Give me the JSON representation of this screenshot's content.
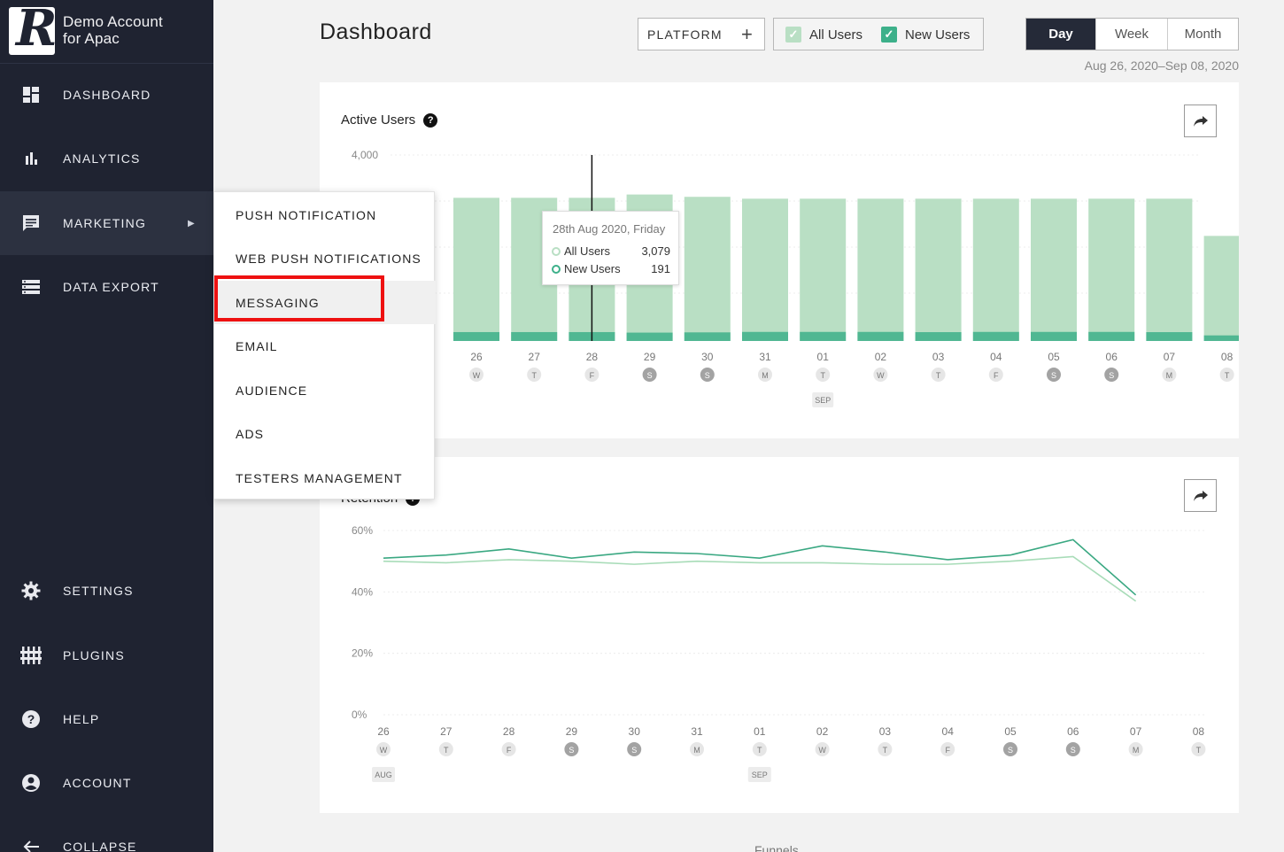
{
  "brand": {
    "line1": "Demo Account",
    "line2": "for Apac",
    "logo_letter": "R"
  },
  "sidebar": {
    "items": [
      {
        "label": "DASHBOARD",
        "icon": "dashboard-icon"
      },
      {
        "label": "ANALYTICS",
        "icon": "bar-chart-icon"
      },
      {
        "label": "MARKETING",
        "icon": "message-icon",
        "active": true
      },
      {
        "label": "DATA EXPORT",
        "icon": "data-export-icon"
      },
      {
        "label": "SETTINGS",
        "icon": "gear-icon"
      },
      {
        "label": "PLUGINS",
        "icon": "plugins-icon"
      },
      {
        "label": "HELP",
        "icon": "help-icon"
      },
      {
        "label": "ACCOUNT",
        "icon": "account-icon"
      },
      {
        "label": "COLLAPSE",
        "icon": "arrow-left-icon"
      }
    ]
  },
  "header": {
    "title": "Dashboard",
    "platform_label": "PLATFORM",
    "platform_add": "+",
    "check_all_users": "All Users",
    "check_new_users": "New Users",
    "periods": [
      "Day",
      "Week",
      "Month"
    ],
    "selected_period": "Day",
    "date_range": "Aug 26, 2020–Sep 08, 2020"
  },
  "marketing_menu": {
    "items": [
      "PUSH NOTIFICATION",
      "WEB PUSH NOTIFICATIONS",
      "MESSAGING",
      "EMAIL",
      "AUDIENCE",
      "ADS",
      "TESTERS MANAGEMENT"
    ],
    "hovered": "MESSAGING"
  },
  "active_users_card": {
    "title": "Active Users",
    "help": "?",
    "tooltip": {
      "title": "28th Aug 2020, Friday",
      "rows": [
        {
          "label": "All Users",
          "value": "3,079"
        },
        {
          "label": "New Users",
          "value": "191"
        }
      ]
    }
  },
  "retention_card": {
    "title": "Retention"
  },
  "funnels_label": "Funnels",
  "colors": {
    "sidebar_bg": "#1f2331",
    "all_users": "#b9dfc4",
    "new_users": "#3db08a",
    "retention_dark": "#3aa882",
    "retention_light": "#a8dcb8",
    "highlight": "#ee1111"
  },
  "chart_data": [
    {
      "type": "bar",
      "title": "Active Users",
      "categories": [
        "26",
        "27",
        "28",
        "29",
        "30",
        "31",
        "01",
        "02",
        "03",
        "04",
        "05",
        "06",
        "07",
        "08"
      ],
      "weekdays": [
        "W",
        "T",
        "F",
        "S",
        "S",
        "M",
        "T",
        "W",
        "T",
        "F",
        "S",
        "S",
        "M",
        "T"
      ],
      "month_markers": [
        {
          "index": 6,
          "label": "SEP"
        }
      ],
      "yticks": [
        "4,000"
      ],
      "ylim": [
        0,
        4000
      ],
      "series": [
        {
          "name": "All Users",
          "values": [
            3079,
            3079,
            3079,
            3150,
            3100,
            3060,
            3060,
            3060,
            3060,
            3060,
            3060,
            3060,
            3060,
            2260
          ]
        },
        {
          "name": "New Users",
          "values": [
            191,
            191,
            191,
            180,
            185,
            195,
            195,
            195,
            190,
            195,
            195,
            195,
            190,
            120
          ]
        }
      ],
      "cursor_index": 2,
      "grid": true
    },
    {
      "type": "line",
      "title": "Retention",
      "categories": [
        "26",
        "27",
        "28",
        "29",
        "30",
        "31",
        "01",
        "02",
        "03",
        "04",
        "05",
        "06",
        "07",
        "08"
      ],
      "weekdays": [
        "W",
        "T",
        "F",
        "S",
        "S",
        "M",
        "T",
        "W",
        "T",
        "F",
        "S",
        "S",
        "M",
        "T"
      ],
      "month_markers": [
        {
          "index": 0,
          "label": "AUG"
        },
        {
          "index": 6,
          "label": "SEP"
        }
      ],
      "yticks": [
        "60%",
        "40%",
        "20%",
        "0%"
      ],
      "ylim": [
        0,
        60
      ],
      "series": [
        {
          "name": "All Users",
          "values": [
            51,
            52,
            54,
            51,
            53,
            52.5,
            51,
            55,
            53,
            50.5,
            52,
            57,
            39,
            null
          ]
        },
        {
          "name": "New Users",
          "values": [
            50,
            49.5,
            50.5,
            50,
            49,
            50,
            49.5,
            49.5,
            49,
            49,
            50,
            51.5,
            37,
            null
          ]
        }
      ],
      "grid": true
    }
  ]
}
